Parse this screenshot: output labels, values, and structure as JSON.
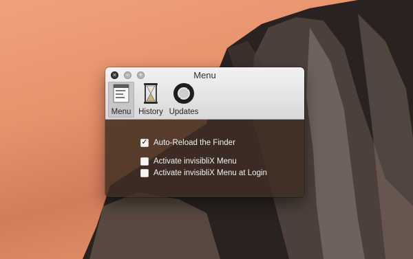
{
  "window": {
    "title": "Menu",
    "tabs": [
      {
        "label": "Menu",
        "icon": "menu-list-icon",
        "selected": true
      },
      {
        "label": "History",
        "icon": "hourglass-icon",
        "selected": false
      },
      {
        "label": "Updates",
        "icon": "refresh-icon",
        "selected": false
      }
    ],
    "options": [
      {
        "label": "Auto-Reload the Finder",
        "checked": true
      },
      {
        "label": "Activate invisibliX Menu",
        "checked": false
      },
      {
        "label": "Activate invisibliX Menu at Login",
        "checked": false
      }
    ],
    "checkmark": "✓"
  },
  "controls": {
    "close_glyph": "×",
    "minimize_glyph": "−",
    "zoom_glyph": "+"
  },
  "colors": {
    "content_bg": "#3e2e22",
    "titlebar": "#e3e3e3",
    "selected_tab": "#c7c7c7"
  }
}
